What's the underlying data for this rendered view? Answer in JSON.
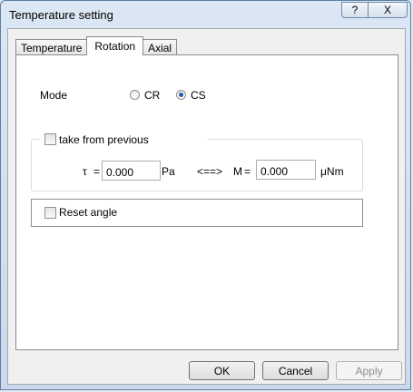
{
  "window": {
    "title": "Temperature setting"
  },
  "titlebar": {
    "help_glyph": "?",
    "close_glyph": "X"
  },
  "tabs": [
    {
      "label": "Temperature",
      "active": false
    },
    {
      "label": "Rotation",
      "active": true
    },
    {
      "label": "Axial",
      "active": false
    }
  ],
  "mode": {
    "label": "Mode",
    "options": [
      {
        "label": "CR",
        "selected": false
      },
      {
        "label": "CS",
        "selected": true
      }
    ]
  },
  "previous": {
    "checkbox_label": "take from previous",
    "checked": false,
    "tau_symbol": "τ",
    "equals": "=",
    "tau_value": "0.000",
    "tau_unit": "Pa",
    "arrow": "<==>",
    "m_symbol": "M",
    "m_value": "0.000",
    "m_unit": "μNm"
  },
  "reset": {
    "label": "Reset angle",
    "checked": false
  },
  "buttons": {
    "ok": "OK",
    "cancel": "Cancel",
    "apply": "Apply"
  }
}
